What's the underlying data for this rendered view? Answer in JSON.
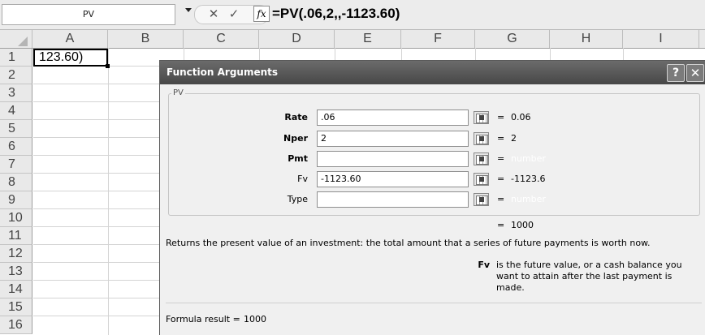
{
  "formula_bar": {
    "name_box": "PV",
    "formula": "=PV(.06,2,,-1123.60)"
  },
  "grid": {
    "columns": [
      "A",
      "B",
      "C",
      "D",
      "E",
      "F",
      "G",
      "H",
      "I"
    ],
    "rows": [
      "1",
      "2",
      "3",
      "4",
      "5",
      "6",
      "7",
      "8",
      "9",
      "10",
      "11",
      "12",
      "13",
      "14",
      "15",
      "16"
    ],
    "cell_a1": "123.60)"
  },
  "dialog": {
    "title": "Function Arguments",
    "help_glyph": "?",
    "close_glyph": "✕",
    "group_label": "PV",
    "args": [
      {
        "label": "Rate",
        "value": ".06",
        "result": "0.06"
      },
      {
        "label": "Nper",
        "value": "2",
        "result": "2"
      },
      {
        "label": "Pmt",
        "value": "",
        "result": "number"
      },
      {
        "label": "Fv",
        "value": "-1123.60",
        "result": "-1123.6"
      },
      {
        "label": "Type",
        "value": "",
        "result": "number"
      }
    ],
    "eq": "=",
    "result": "1000",
    "description": "Returns the present value of an investment: the total amount that a series of future payments is worth now.",
    "arg_help_name": "Fv",
    "arg_help_text": "is the future value, or a cash balance you want to attain after the last payment is made.",
    "formula_result_label": "Formula result =",
    "formula_result_value": "1000"
  },
  "icons": {
    "cancel": "cancel-x-icon",
    "enter": "checkmark-icon",
    "function": "fx-icon",
    "collapse": "collapse-dialog-icon"
  },
  "colors": {
    "title_bar": "#474747",
    "dialog_bg": "#f0f0f0"
  }
}
